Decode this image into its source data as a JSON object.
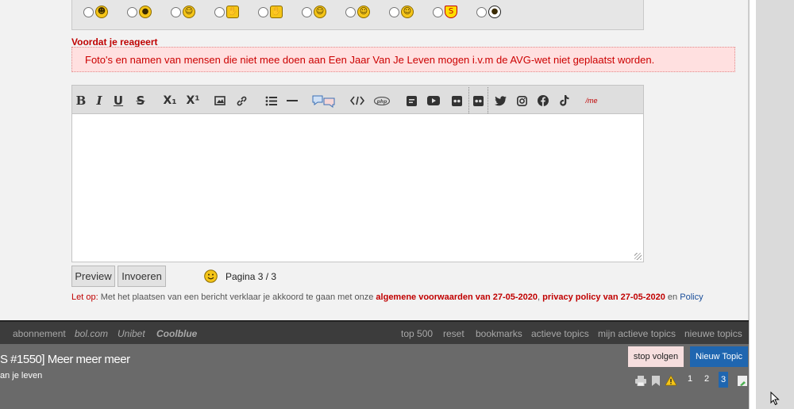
{
  "smileys": [
    {
      "icon": "grin-smiley-icon",
      "glyph": "☻"
    },
    {
      "icon": "surprised-smiley-icon",
      "glyph": "●"
    },
    {
      "icon": "smile-smiley-icon",
      "glyph": "☺"
    },
    {
      "icon": "thumbs-down-smiley-icon",
      "glyph": "✋"
    },
    {
      "icon": "thumbs-up-smiley-icon",
      "glyph": "✋"
    },
    {
      "icon": "neutral-smiley-icon",
      "glyph": "☺"
    },
    {
      "icon": "wink-kiss-smiley-icon",
      "glyph": "☺"
    },
    {
      "icon": "angel-smiley-icon",
      "glyph": "☺"
    },
    {
      "icon": "superman-icon",
      "glyph": "S"
    },
    {
      "icon": "soccer-ball-icon",
      "glyph": "●"
    }
  ],
  "warning": {
    "title": "Voordat je reageert",
    "text": "Foto's en namen van mensen die niet mee doen aan Een Jaar Van Je Leven mogen i.v.m de AVG-wet niet geplaatst worden."
  },
  "toolbar": {
    "bold": "B",
    "italic": "I",
    "underline": "U",
    "strike": "S",
    "subscript": "X₁",
    "superscript": "X¹",
    "me": "/me"
  },
  "buttons": {
    "preview": "Preview",
    "submit": "Invoeren"
  },
  "pagination_label": "Pagina 3 / 3",
  "terms": {
    "prefix": "Let op",
    "colon": ":",
    "text": " Met het plaatsen van een bericht verklaar je akkoord te gaan met onze ",
    "link1": "algemene voorwaarden van 27-05-2020",
    "comma": ", ",
    "link2": "privacy policy van 27-05-2020",
    "and": " en ",
    "link3": "Policy"
  },
  "footer_nav": {
    "abonnement": "abonnement",
    "bolcom": "bol.com",
    "unibet": "Unibet",
    "coolblue": "Coolblue",
    "top500": "top 500",
    "reset": "reset",
    "bookmarks": "bookmarks",
    "actieve": "actieve topics",
    "mijn": "mijn actieve topics",
    "nieuwe": "nieuwe topics"
  },
  "topic": {
    "title": "S #1550] Meer meer meer",
    "subtitle": "an je leven",
    "stop_follow": "stop volgen",
    "new_topic": "Nieuw Topic",
    "pages": [
      "1",
      "2",
      "3"
    ],
    "current_page": "3"
  },
  "colors": {
    "accent_red": "#c00000",
    "brand_blue": "#1f66b0"
  }
}
